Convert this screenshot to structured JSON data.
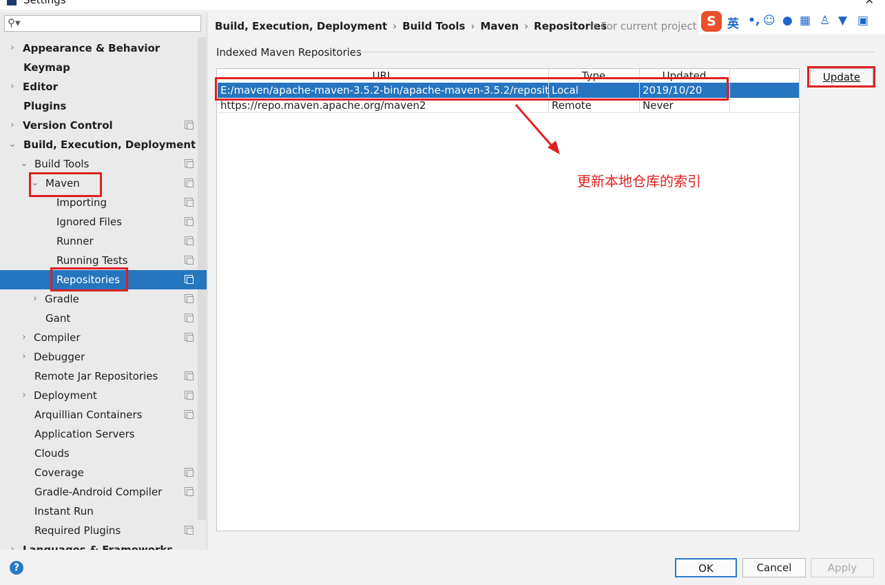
{
  "window": {
    "title": "Settings"
  },
  "ime_toolbar": {
    "logo": "S",
    "mode": "英",
    "icons": [
      "punctuation-icon",
      "emoji-icon",
      "microphone-icon",
      "keyboard-icon",
      "user-icon",
      "skin-icon",
      "grid-icon"
    ]
  },
  "sidebar": {
    "search_placeholder": "",
    "items": [
      {
        "label": "Appearance & Behavior",
        "bold": true,
        "arrow": "right",
        "copy": false
      },
      {
        "label": "Keymap",
        "bold": true,
        "arrow": "",
        "copy": false
      },
      {
        "label": "Editor",
        "bold": true,
        "arrow": "right",
        "copy": false
      },
      {
        "label": "Plugins",
        "bold": true,
        "arrow": "",
        "copy": false
      },
      {
        "label": "Version Control",
        "bold": true,
        "arrow": "right",
        "copy": true
      },
      {
        "label": "Build, Execution, Deployment",
        "bold": true,
        "arrow": "down",
        "copy": false
      },
      {
        "label": "Build Tools",
        "bold": false,
        "arrow": "down",
        "copy": true
      },
      {
        "label": "Maven",
        "bold": false,
        "arrow": "down",
        "copy": true
      },
      {
        "label": "Importing",
        "bold": false,
        "arrow": "",
        "copy": true
      },
      {
        "label": "Ignored Files",
        "bold": false,
        "arrow": "",
        "copy": true
      },
      {
        "label": "Runner",
        "bold": false,
        "arrow": "",
        "copy": true
      },
      {
        "label": "Running Tests",
        "bold": false,
        "arrow": "",
        "copy": true
      },
      {
        "label": "Repositories",
        "bold": false,
        "arrow": "",
        "copy": true,
        "selected": true
      },
      {
        "label": "Gradle",
        "bold": false,
        "arrow": "right",
        "copy": true
      },
      {
        "label": "Gant",
        "bold": false,
        "arrow": "",
        "copy": true
      },
      {
        "label": "Compiler",
        "bold": false,
        "arrow": "right",
        "copy": true
      },
      {
        "label": "Debugger",
        "bold": false,
        "arrow": "right",
        "copy": false
      },
      {
        "label": "Remote Jar Repositories",
        "bold": false,
        "arrow": "",
        "copy": true
      },
      {
        "label": "Deployment",
        "bold": false,
        "arrow": "right",
        "copy": true
      },
      {
        "label": "Arquillian Containers",
        "bold": false,
        "arrow": "",
        "copy": true
      },
      {
        "label": "Application Servers",
        "bold": false,
        "arrow": "",
        "copy": false
      },
      {
        "label": "Clouds",
        "bold": false,
        "arrow": "",
        "copy": false
      },
      {
        "label": "Coverage",
        "bold": false,
        "arrow": "",
        "copy": true
      },
      {
        "label": "Gradle-Android Compiler",
        "bold": false,
        "arrow": "",
        "copy": true
      },
      {
        "label": "Instant Run",
        "bold": false,
        "arrow": "",
        "copy": false
      },
      {
        "label": "Required Plugins",
        "bold": false,
        "arrow": "",
        "copy": true
      },
      {
        "label": "Languages & Frameworks",
        "bold": true,
        "arrow": "right",
        "copy": false
      }
    ]
  },
  "breadcrumb": [
    "Build, Execution, Deployment",
    "Build Tools",
    "Maven",
    "Repositories"
  ],
  "scope_label": "For current project",
  "group_title": "Indexed Maven Repositories",
  "table": {
    "headers": [
      "URL",
      "Type",
      "Updated"
    ],
    "rows": [
      [
        "E:/maven/apache-maven-3.5.2-bin/apache-maven-3.5.2/reposit...",
        "Local",
        "2019/10/20"
      ],
      [
        "https://repo.maven.apache.org/maven2",
        "Remote",
        "Never"
      ]
    ]
  },
  "update_label": "Update",
  "annotation_note": "更新本地仓库的索引",
  "footer": {
    "help": "?",
    "ok": "OK",
    "cancel": "Cancel",
    "apply": "Apply"
  },
  "colors": {
    "selection": "#2675bf",
    "annotation": "#e02020",
    "ime_logo": "#e8512a"
  }
}
